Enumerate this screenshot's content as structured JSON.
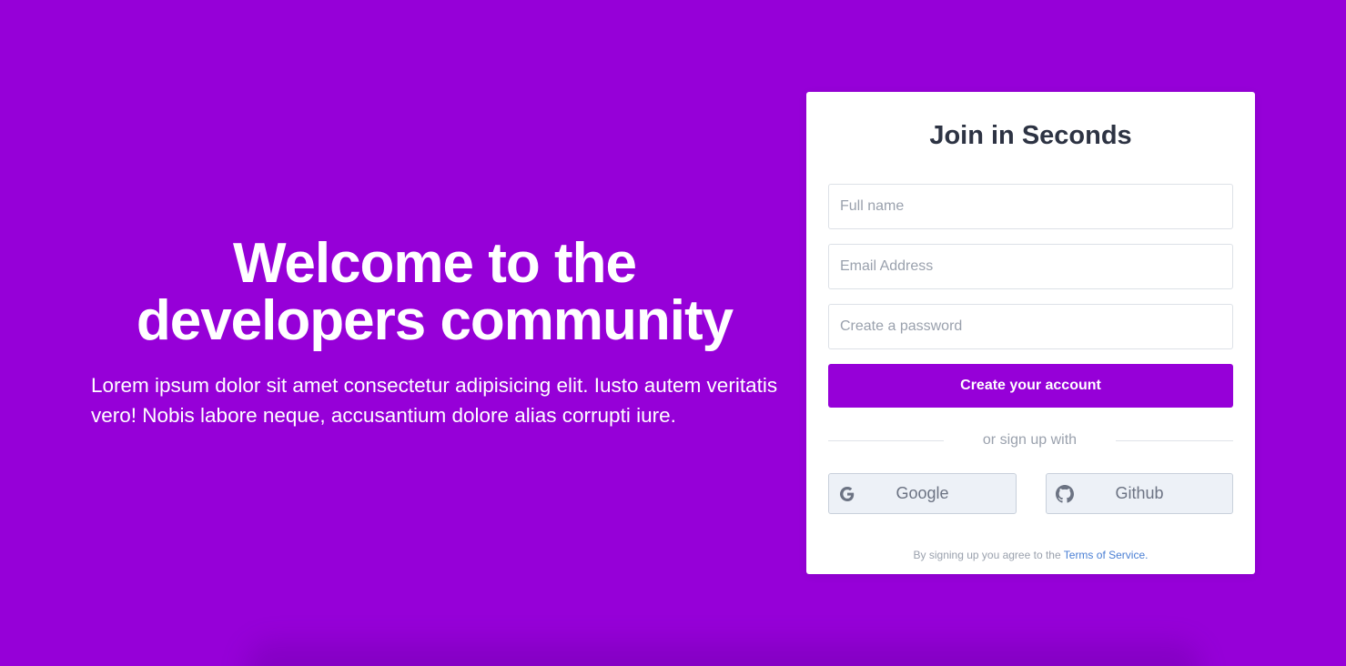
{
  "colors": {
    "background": "#9600d8",
    "accent": "#9600d8",
    "card": "#ffffff",
    "heading": "#2d3343",
    "muted": "#9aa1ad",
    "link": "#4a7fd4"
  },
  "hero": {
    "title_line1": "Welcome to the",
    "title_line2": "developers community",
    "text": "Lorem ipsum dolor sit amet consectetur adipisicing elit. Iusto autem veritatis vero! Nobis labore neque, accusantium dolore alias corrupti iure."
  },
  "signup": {
    "title": "Join in Seconds",
    "fields": {
      "full_name": {
        "placeholder": "Full name",
        "value": ""
      },
      "email": {
        "placeholder": "Email Address",
        "value": ""
      },
      "password": {
        "placeholder": "Create a password",
        "value": ""
      }
    },
    "submit_label": "Create your account",
    "divider_text": "or sign up with",
    "social": [
      {
        "label": "Google",
        "icon": "google-icon"
      },
      {
        "label": "Github",
        "icon": "github-icon"
      }
    ],
    "terms_prefix": "By signing up you agree to the",
    "terms_link": "Terms of Service."
  }
}
